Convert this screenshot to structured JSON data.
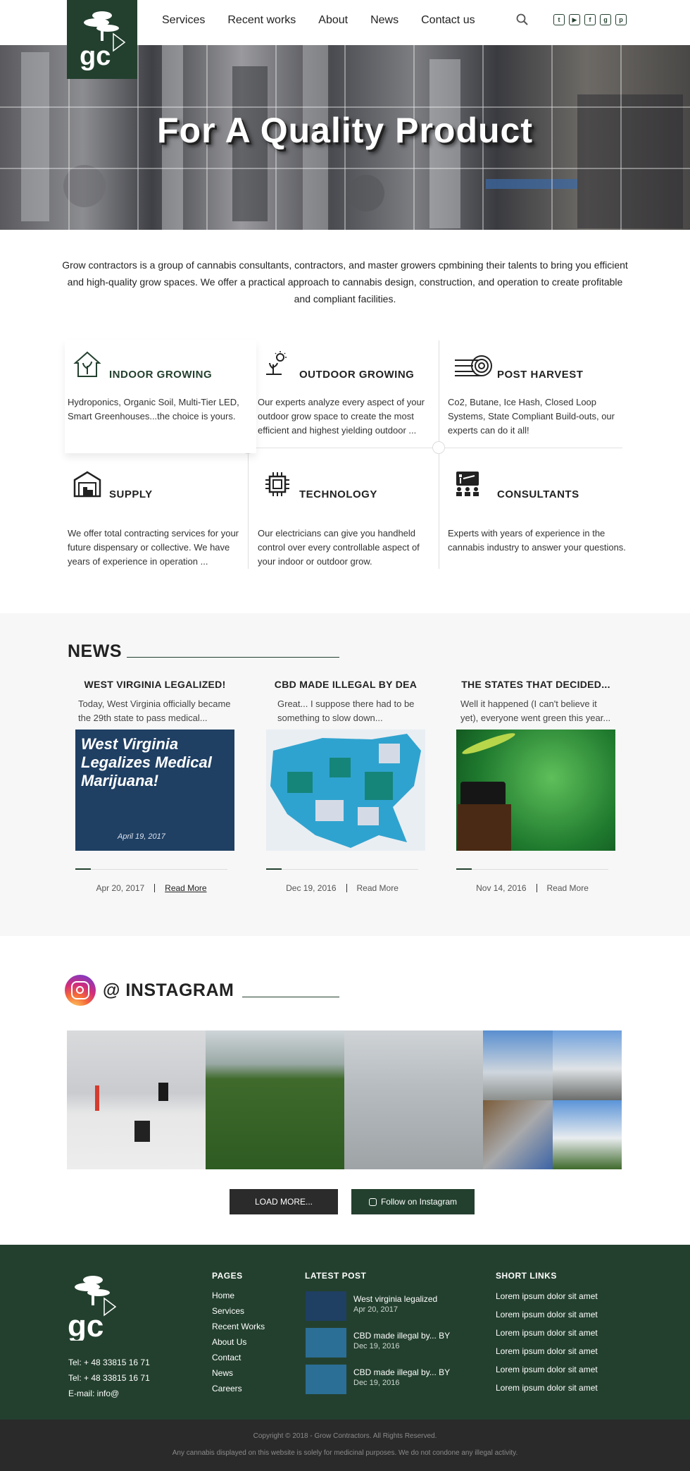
{
  "header": {
    "logo_text": "gc",
    "nav": [
      "Services",
      "Recent works",
      "About",
      "News",
      "Contact us"
    ],
    "socials": [
      "twitter-icon",
      "youtube-icon",
      "facebook-icon",
      "google-plus-icon",
      "pinterest-icon"
    ]
  },
  "hero": {
    "title": "For  A Quality Product"
  },
  "intro": {
    "text": "Grow contractors is a group of cannabis consultants, contractors, and master growers cpmbining their talents to bring you efficient and high-quality grow spaces. We offer a practical approach  to cannabis design, construction, and operation to create profitable and compliant  facilities."
  },
  "features": [
    {
      "title": "INDOOR GROWING",
      "text": "Hydroponics, Organic Soil, Multi-Tier LED, Smart Greenhouses...the choice is yours."
    },
    {
      "title": "OUTDOOR GROWING",
      "text": "Our experts analyze every aspect of your outdoor grow space to create the most efficient and highest yielding outdoor ..."
    },
    {
      "title": "POST HARVEST",
      "text": "Co2, Butane, Ice Hash, Closed Loop Systems, State Compliant Build-outs, our experts can do it all!"
    },
    {
      "title": "SUPPLY",
      "text": "We offer total contracting services for your future dispensary or collective. We have years of experience in operation ..."
    },
    {
      "title": "TECHNOLOGY",
      "text": "Our electricians can give you handheld control over every controllable aspect of your indoor or outdoor grow."
    },
    {
      "title": "CONSULTANTS",
      "text": "Experts with years of experience in the cannabis industry to answer your questions."
    }
  ],
  "news": {
    "title": "NEWS",
    "cards": [
      {
        "title": "WEST VIRGINIA LEGALIZED!",
        "excerpt": "Today, West Virginia officially became the 29th state to pass medical...",
        "img_text": "West Virginia Legalizes Medical Marijuana!",
        "img_date": "April 19, 2017",
        "date": "Apr 20, 2017",
        "read_more": "Read More"
      },
      {
        "title": "CBD MADE ILLEGAL BY DEA",
        "excerpt": "Great... I suppose there had to be something to slow down...",
        "date": "Dec 19, 2016",
        "read_more": "Read More"
      },
      {
        "title": "THE STATES THAT DECIDED...",
        "excerpt": "Well it happened (I can't believe it yet), everyone went green this year...",
        "date": "Nov 14, 2016",
        "read_more": "Read More"
      }
    ]
  },
  "instagram": {
    "title": "@ INSTAGRAM",
    "load_more": "LOAD MORE...",
    "follow": "Follow on Instagram"
  },
  "footer": {
    "phone1": "Tel: + 48 33815 16 71",
    "phone2": "Tel: + 48 33815 16 71",
    "email": "E-mail: info@",
    "pages_title": "PAGES",
    "pages": [
      "Home",
      "Services",
      "Recent Works",
      "About Us",
      "Contact",
      "News",
      "Careers"
    ],
    "latest_title": "LATEST POST",
    "posts": [
      {
        "title": "West virginia legalized",
        "date": "Apr 20, 2017"
      },
      {
        "title": "CBD made illegal by... BY",
        "date": "Dec 19, 2016"
      },
      {
        "title": "CBD made illegal by... BY",
        "date": "Dec 19, 2016"
      }
    ],
    "short_title": "SHORT LINKS",
    "short_links": [
      "Lorem ipsum dolor sit amet",
      "Lorem ipsum dolor sit amet",
      "Lorem ipsum dolor sit amet",
      "Lorem ipsum dolor sit amet",
      "Lorem ipsum dolor sit amet",
      "Lorem ipsum dolor sit amet"
    ],
    "copyright": "Copyright © 2018 - Grow Contractors. All Rights Reserved.",
    "disclaimer": "Any cannabis displayed on this website is solely for medicinal purposes. We do not condone any illegal activity."
  },
  "colors": {
    "brand_green": "#23402e",
    "dark_btn": "#2b2b2b",
    "footer_bottom": "#2a2a2a"
  }
}
